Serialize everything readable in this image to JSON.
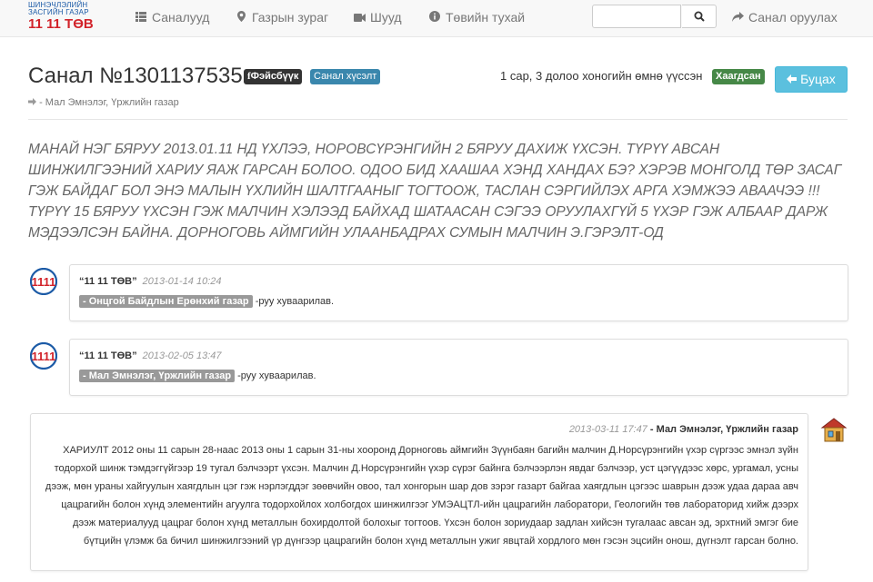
{
  "logo": {
    "line1": "ШИНЭЧЛЭЛИЙН",
    "line2": "ЗАСГИЙН ГАЗАР",
    "line3": "11 11 ТӨВ"
  },
  "nav": {
    "items": [
      {
        "icon": "list-icon",
        "label": "Саналууд"
      },
      {
        "icon": "map-marker-icon",
        "label": "Газрын зураг"
      },
      {
        "icon": "video-camera-icon",
        "label": "Шууд"
      },
      {
        "icon": "info-icon",
        "label": "Төвийн тухай"
      }
    ],
    "search_placeholder": "",
    "submit_label": "Санал оруулах"
  },
  "header": {
    "title": "Санал №1301137535",
    "facebook_badge": "Фэйсбүүк",
    "type_badge": "Санал хүсэлт",
    "created_text": "1 сар, 3 долоо хоногийн өмнө үүссэн",
    "status_badge": "Хаагдсан",
    "back_label": "Буцах",
    "breadcrumb": "- Мал Эмнэлэг, Үржлийн газар",
    "colors": {
      "facebook": "#333333",
      "type": "#3a87ad",
      "status": "#468847",
      "back": "#5bc0de"
    }
  },
  "complaint_text": "МАНАЙ НЭГ БЯРУУ 2013.01.11 НД ҮХЛЭЭ, НОРОВСҮРЭНГИЙН 2 БЯРУУ ДАХИЖ ҮХСЭН. ТҮРҮҮ АВСАН ШИНЖИЛГЭЭНИЙ ХАРИУ ЯАЖ ГАРСАН БОЛОО. ОДОО БИД ХААШАА ХЭНД ХАНДАХ БЭ? ХЭРЭВ МОНГОЛД ТӨР ЗАСАГ ГЭЖ БАЙДАГ БОЛ ЭНЭ МАЛЫН ҮХЛИЙН ШАЛТГААНЫГ ТОГТООЖ, ТАСЛАН СЭРГИЙЛЭХ АРГА ХЭМЖЭЭ АВААЧЭЭ !!! ТҮРҮҮ 15 БЯРУУ ҮХСЭН ГЭЖ МАЛЧИН ХЭЛЭЭД БАЙХАД ШАТААСАН СЭГЭЭ ОРУУЛАХГҮЙ 5 ҮХЭР ГЭЖ АЛБААР ДАРЖ МЭДЭЭЛСЭН БАЙНА. ДОРНОГОВЬ АЙМГИЙН УЛААНБАДРАХ СУМЫН МАЛЧИН Э.ГЭРЭЛТ-ОД",
  "events": [
    {
      "author": "“11 11 ТӨВ”",
      "time": "2013-01-14 10:24",
      "org": "- Онцгой Байдлын Ерөнхий газар",
      "suffix": "-руу хуваарилав."
    },
    {
      "author": "“11 11 ТӨВ”",
      "time": "2013-02-05 13:47",
      "org": "- Мал Эмнэлэг, Үржлийн газар",
      "suffix": "-руу хуваарилав."
    }
  ],
  "reply": {
    "time": "2013-03-11 17:47",
    "org": "- Мал Эмнэлэг, Үржлийн газар",
    "text": "ХАРИУЛТ 2012 оны 11 сарын 28-наас 2013 оны 1 сарын 31-ны хооронд Дорноговь аймгийн Зүүнбаян багийн малчин Д.Норсүрэнгийн үхэр сүргээс эмнэл зүйн тодорхой шинж тэмдэггүйгээр 19 тугал бэлчээрт үхсэн. Малчин Д.Норсүрэнгийн үхэр сүрэг байнга бэлчээрлэн явдаг бэлчээр, уст цэгүүдээс хөрс, ургамал, усны дээж, мөн ураны хайгуулын хаягдлын цэг гэж нэрлэгддэг зөөвчийн овоо, тал хонгорын шар дов зэрэг газарт байгаа хаягдлын цэгээс шаврын дээж удаа дараа авч цацрагийн болон хүнд элементийн агуулга тодорхойлох холбогдох шинжилгээг УМЭАЦТЛ-ийн цацрагийн лаборатори, Геологийн төв лабораторид хийж дээрх дээж материалууд цацраг болон хүнд металлын бохирдолтой болохыг тогтоов. Үхсэн болон зориудаар задлан хийсэн тугалаас авсан эд, эрхтний эмгэг бие бүтцийн үлэмж ба бичил шинжилгээний үр дүнгээр цацрагийн болон хүнд металлын ужиг явцтай хордлого мөн гэсэн эцсийн онош, дүгнэлт гарсан болно."
  }
}
